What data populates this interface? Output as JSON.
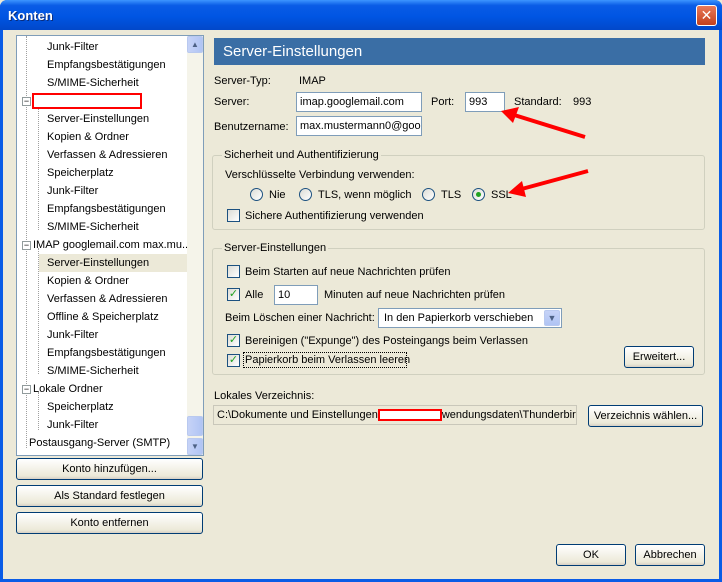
{
  "window": {
    "title": "Konten",
    "close_glyph": "✕"
  },
  "tree": {
    "items": [
      {
        "label": "Junk-Filter"
      },
      {
        "label": "Empfangsbestätigungen"
      },
      {
        "label": "S/MIME-Sicherheit"
      },
      {
        "label": ""
      },
      {
        "label": "Server-Einstellungen"
      },
      {
        "label": "Kopien & Ordner"
      },
      {
        "label": "Verfassen & Adressieren"
      },
      {
        "label": "Speicherplatz"
      },
      {
        "label": "Junk-Filter"
      },
      {
        "label": "Empfangsbestätigungen"
      },
      {
        "label": "S/MIME-Sicherheit"
      },
      {
        "label": "IMAP googlemail.com max.mu..."
      },
      {
        "label": "Server-Einstellungen"
      },
      {
        "label": "Kopien & Ordner"
      },
      {
        "label": "Verfassen & Adressieren"
      },
      {
        "label": "Offline & Speicherplatz"
      },
      {
        "label": "Junk-Filter"
      },
      {
        "label": "Empfangsbestätigungen"
      },
      {
        "label": "S/MIME-Sicherheit"
      },
      {
        "label": "Lokale Ordner"
      },
      {
        "label": "Speicherplatz"
      },
      {
        "label": "Junk-Filter"
      },
      {
        "label": "Postausgang-Server (SMTP)"
      }
    ],
    "expander_minus": "−"
  },
  "left_buttons": {
    "add": "Konto hinzufügen...",
    "default": "Als Standard festlegen",
    "remove": "Konto entfernen"
  },
  "panel": {
    "header": "Server-Einstellungen",
    "server_type_label": "Server-Typ:",
    "server_type_value": "IMAP",
    "server_label": "Server:",
    "server_value": "imap.googlemail.com",
    "port_label": "Port:",
    "port_value": "993",
    "standard_label": "Standard:",
    "standard_value": "993",
    "username_label": "Benutzername:",
    "username_value": "max.mustermann0@goo"
  },
  "security": {
    "title": "Sicherheit und Authentifizierung",
    "encrypted_label": "Verschlüsselte Verbindung verwenden:",
    "options": [
      "Nie",
      "TLS, wenn möglich",
      "TLS",
      "SSL"
    ],
    "selected": "SSL",
    "secure_auth_label": "Sichere Authentifizierung verwenden",
    "secure_auth_checked": false
  },
  "server_settings": {
    "title": "Server-Einstellungen",
    "check_on_start": "Beim Starten auf neue Nachrichten prüfen",
    "check_on_start_checked": false,
    "every_label": "Alle",
    "every_checked": true,
    "minutes_value": "10",
    "minutes_label": "Minuten auf neue Nachrichten prüfen",
    "on_delete_label": "Beim Löschen einer Nachricht:",
    "on_delete_value": "In den Papierkorb verschieben",
    "expunge_label": "Bereinigen (\"Expunge\") des Posteingangs beim Verlassen",
    "expunge_checked": true,
    "empty_trash_label": "Papierkorb beim Verlassen leeren",
    "empty_trash_checked": true,
    "advanced_button": "Erweitert..."
  },
  "local_dir": {
    "label": "Lokales Verzeichnis:",
    "path_start": "C:\\Dokumente und Einstellungen",
    "path_end": "wendungsdaten\\Thunderbird",
    "choose_button": "Verzeichnis wählen..."
  },
  "footer": {
    "ok": "OK",
    "cancel": "Abbrechen"
  },
  "colors": {
    "annotation_red": "#ff0000",
    "header_blue": "#3a6ea5",
    "titlebar_blue": "#0a5ce6"
  }
}
